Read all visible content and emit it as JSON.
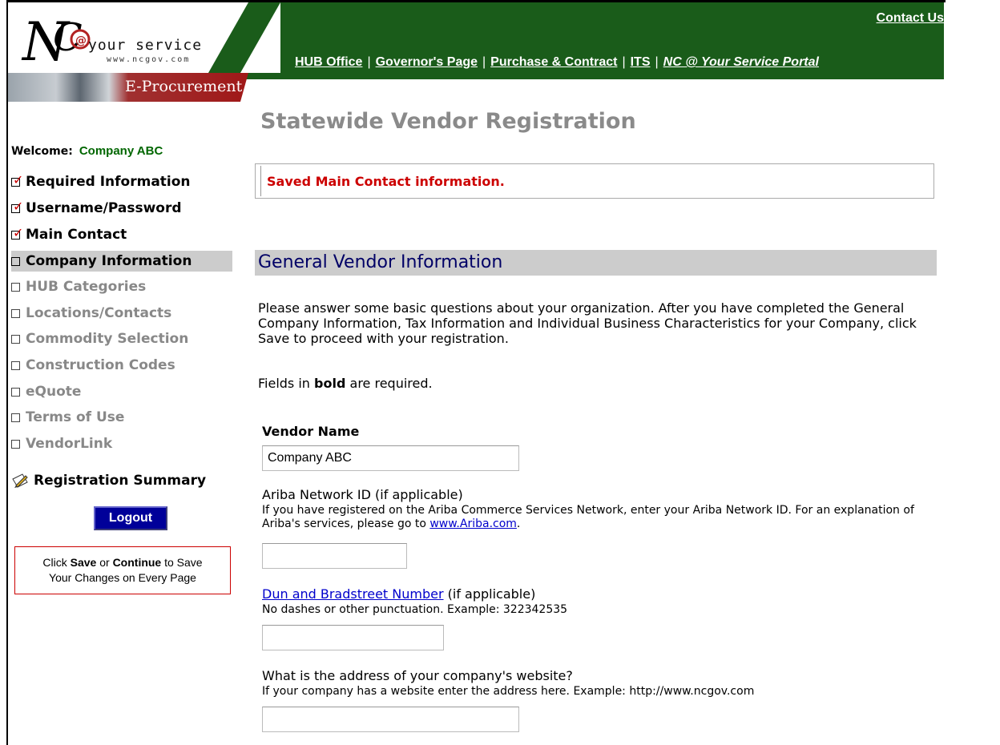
{
  "header": {
    "logo_text": "your service",
    "logo_sub": "www.ncgov.com",
    "section_label": "E-Procurement",
    "contact": "Contact Us",
    "nav": [
      "HUB Office",
      "Governor's Page",
      "Purchase & Contract",
      "ITS",
      "NC @ Your Service Portal"
    ],
    "band_color": "#1a5c1a"
  },
  "sidebar": {
    "welcome_label": "Welcome:",
    "welcome_name": "Company ABC",
    "steps": [
      {
        "label": "Required Information",
        "status": "done"
      },
      {
        "label": "Username/Password",
        "status": "done"
      },
      {
        "label": "Main Contact",
        "status": "done"
      },
      {
        "label": "Company Information",
        "status": "active"
      },
      {
        "label": "HUB Categories",
        "status": "todo"
      },
      {
        "label": "Locations/Contacts",
        "status": "todo"
      },
      {
        "label": "Commodity Selection",
        "status": "todo"
      },
      {
        "label": "Construction Codes",
        "status": "todo"
      },
      {
        "label": "eQuote",
        "status": "todo"
      },
      {
        "label": "Terms of Use",
        "status": "todo"
      },
      {
        "label": "VendorLink",
        "status": "todo"
      }
    ],
    "summary": "Registration Summary",
    "logout": "Logout",
    "notice_pre": "Click ",
    "notice_save": "Save",
    "notice_or": " or ",
    "notice_continue": "Continue",
    "notice_post": " to Save",
    "notice_line2": "Your Changes on Every Page"
  },
  "main": {
    "title": "Statewide Vendor Registration",
    "message": "Saved Main Contact information.",
    "section": "General Vendor Information",
    "intro": "Please answer some basic questions about your organization. After you have completed the General Company Information, Tax Information and Individual Business Characteristics for your Company, click Save to proceed with your registration.",
    "req_pre": "Fields in ",
    "req_bold": "bold",
    "req_post": " are required.",
    "vendor_name_label": "Vendor Name",
    "vendor_name_value": "Company ABC",
    "ariba_label": "Ariba Network ID (if applicable)",
    "ariba_help": "If you have registered on the Ariba Commerce Services Network, enter your Ariba Network ID. For an explanation of Ariba's services, please go to ",
    "ariba_link": "www.Ariba.com",
    "ariba_help_end": ".",
    "duns_link": "Dun and Bradstreet Number",
    "duns_label_rest": " (if applicable)",
    "duns_help": "No dashes or other punctuation. Example: 322342535",
    "web_label": "What is the address of your company's website?",
    "web_help": "If your company has a website enter the address here. Example: http://www.ncgov.com"
  }
}
